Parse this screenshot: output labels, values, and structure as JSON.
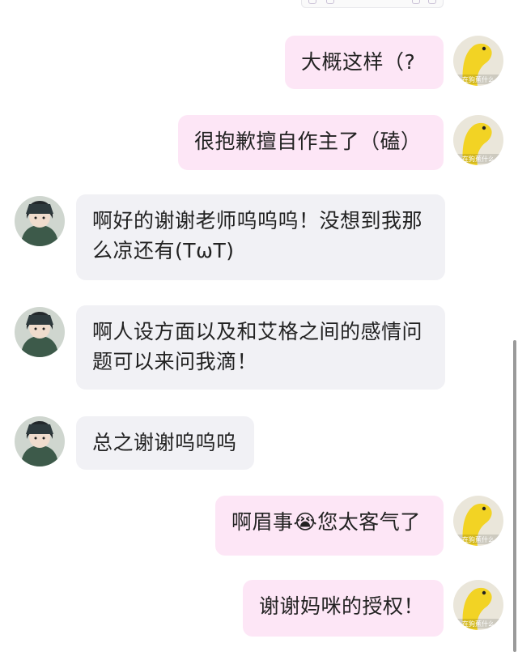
{
  "messages": [
    {
      "side": "right",
      "text": "大概这样（?"
    },
    {
      "side": "right",
      "text": "很抱歉擅自作主了（磕）"
    },
    {
      "side": "left",
      "text": "啊好的谢谢老师呜呜呜！没想到我那么凉还有(TωT)"
    },
    {
      "side": "left",
      "text": "啊人设方面以及和艾格之间的感情问题可以来问我滴！"
    },
    {
      "side": "left",
      "text": "总之谢谢呜呜呜"
    },
    {
      "side": "right",
      "text": "啊眉事😭您太客气了"
    },
    {
      "side": "right",
      "text": "谢谢妈咪的授权！"
    }
  ],
  "self_avatar": {
    "icon": "banana-avatar-icon",
    "watermark": "在狗蕉什么"
  },
  "other_avatar": {
    "icon": "anime-character-avatar-icon"
  },
  "colors": {
    "outgoing_bubble": "#fde6f6",
    "incoming_bubble": "#f1f1f5"
  }
}
